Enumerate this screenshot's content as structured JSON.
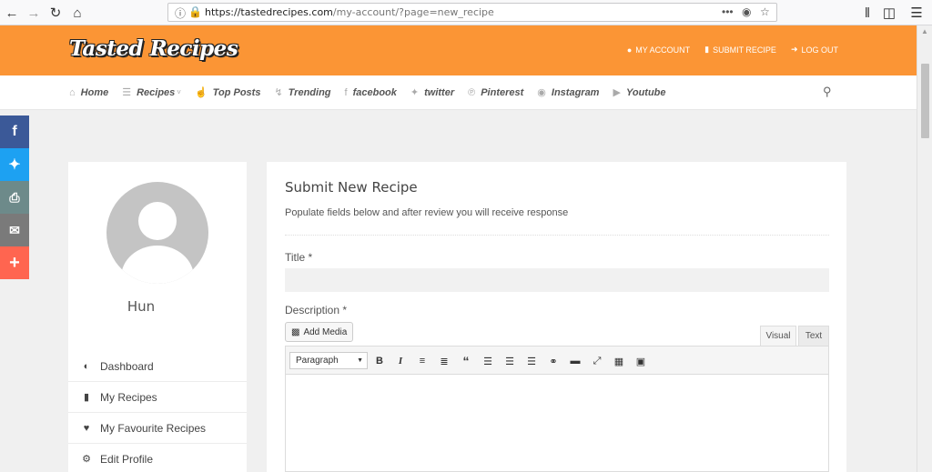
{
  "browser": {
    "url_host": "https://tastedrecipes.com",
    "url_path": "/my-account/?page=new_recipe"
  },
  "site": {
    "logo": "Tasted Recipes",
    "top_links": [
      {
        "label": "MY ACCOUNT",
        "icon": "user-icon"
      },
      {
        "label": "SUBMIT RECIPE",
        "icon": "book-icon"
      },
      {
        "label": "LOG OUT",
        "icon": "signout-icon"
      }
    ],
    "nav": [
      {
        "label": "Home",
        "icon": "home-icon"
      },
      {
        "label": "Recipes",
        "icon": "cutlery-icon"
      },
      {
        "label": "Top Posts",
        "icon": "thumbs-up-icon"
      },
      {
        "label": "Trending",
        "icon": "bolt-icon"
      },
      {
        "label": "facebook",
        "icon": "facebook-icon"
      },
      {
        "label": "twitter",
        "icon": "twitter-icon"
      },
      {
        "label": "Pinterest",
        "icon": "pinterest-icon"
      },
      {
        "label": "Instagram",
        "icon": "instagram-icon"
      },
      {
        "label": "Youtube",
        "icon": "youtube-icon"
      }
    ]
  },
  "share": [
    {
      "name": "facebook",
      "color": "#3b5998"
    },
    {
      "name": "twitter",
      "color": "#1da1f2"
    },
    {
      "name": "print",
      "color": "#6d8a8a"
    },
    {
      "name": "email",
      "color": "#7a7a7a"
    },
    {
      "name": "more",
      "color": "#ff6550"
    }
  ],
  "profile": {
    "name": "Hun",
    "menu": [
      {
        "label": "Dashboard",
        "icon": "dashboard-icon"
      },
      {
        "label": "My Recipes",
        "icon": "book-icon"
      },
      {
        "label": "My Favourite Recipes",
        "icon": "heart-icon"
      },
      {
        "label": "Edit Profile",
        "icon": "gear-icon"
      }
    ]
  },
  "form": {
    "title": "Submit New Recipe",
    "subtitle": "Populate fields below and after review you will receive response",
    "title_label": "Title *",
    "description_label": "Description *",
    "add_media": "Add Media",
    "tab_visual": "Visual",
    "tab_text": "Text",
    "format_value": "Paragraph"
  },
  "colors": {
    "header": "#fb9535",
    "card": "#ffffff",
    "background": "#f0f0f0"
  }
}
